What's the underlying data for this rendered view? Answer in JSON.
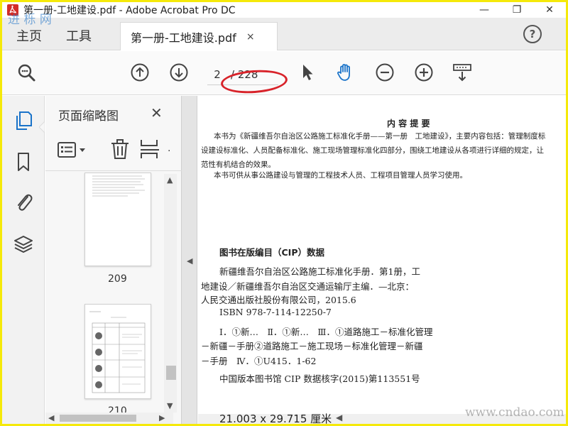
{
  "window": {
    "title": "第一册-工地建设.pdf - Adobe Acrobat Pro DC",
    "minimize": "—",
    "maximize": "❐",
    "close": "✕"
  },
  "tabs": {
    "home": "主页",
    "tools": "工具",
    "document": "第一册-工地建设.pdf",
    "document_close": "×",
    "help": "?"
  },
  "toolbar": {
    "current_page": "2",
    "total_pages": "/ 228"
  },
  "thumbnails_panel": {
    "title": "页面缩略图",
    "close": "✕",
    "pages": [
      {
        "label": "209"
      },
      {
        "label": "210"
      }
    ]
  },
  "document": {
    "summary_heading": "内 容 提 要",
    "summary_lines": [
      "本书为《新疆维吾尔自治区公路施工标准化手册——第一册　工地建设》，主要内容包括：管理制度标",
      "设建设标准化、人员配备标准化、施工现场管理标准化四部分，围绕工地建设从各项进行详细的规定，让",
      "范性有机结合的效果。",
      "本书可供从事公路建设与管理的工程技术人员、工程项目管理人员学习使用。"
    ],
    "cip_heading": "图书在版编目（CIP）数据",
    "cip_lines": [
      "新疆维吾尔自治区公路施工标准化手册．第1册，工",
      "地建设／新疆维吾尔自治区交通运输厅主编．—北京：",
      "人民交通出版社股份有限公司，2015.6",
      "ISBN 978-7-114-12250-7",
      "Ⅰ．①新…　Ⅱ．①新…　Ⅲ．①道路施工－标准化管理",
      "－新疆－手册②道路施工－施工现场－标准化管理－新疆",
      "－手册　Ⅳ．①U415．1-62",
      "中国版本图书馆 CIP 数据核字(2015)第113551号"
    ],
    "page_size": "21.003 x 29.715 厘米"
  },
  "watermarks": {
    "top_left": "进 栎 网",
    "bottom_right": "www.cndao.com"
  },
  "colors": {
    "accent_blue": "#1a73c9",
    "annotation_red": "#d8232a",
    "frame_yellow": "#f5e90a"
  }
}
